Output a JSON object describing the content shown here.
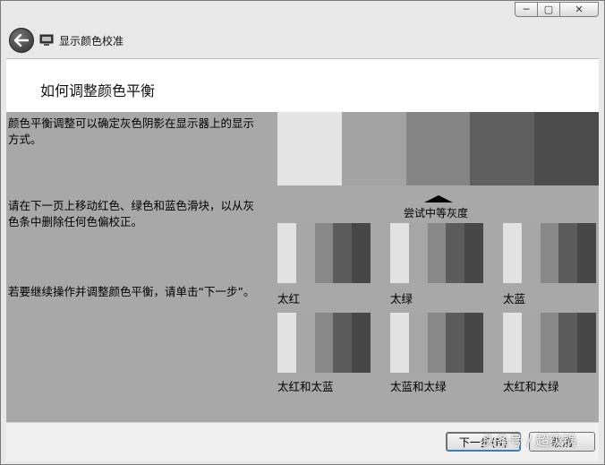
{
  "window": {
    "caption_buttons": [
      {
        "name": "minimize",
        "glyph": "─"
      },
      {
        "name": "maximize",
        "glyph": "▢"
      },
      {
        "name": "close",
        "glyph": "✕"
      }
    ]
  },
  "header": {
    "app_title": "显示颜色校准"
  },
  "page": {
    "title": "如何调整颜色平衡"
  },
  "instructions": [
    "颜色平衡调整可以确定灰色阴影在显示器上的显示方式。",
    "请在下一页上移动红色、绿色和蓝色滑块，以从灰色条中删除任何色偏校正。",
    "若要继续操作并调整颜色平衡，请单击“下一步”。"
  ],
  "reference": {
    "target_label": "尝试中等灰度",
    "colors": [
      "#e4e4e4",
      "#a3a3a3",
      "#858585",
      "#5f5f5f",
      "#4b4b4b"
    ]
  },
  "strip_colors": [
    "#e2e2e2",
    "#a6a6a6",
    "#888888",
    "#5c5c5c",
    "#474747"
  ],
  "samples": [
    {
      "label": "太红"
    },
    {
      "label": "太绿"
    },
    {
      "label": "太蓝"
    },
    {
      "label": "太红和太蓝"
    },
    {
      "label": "太蓝和太绿"
    },
    {
      "label": "太红和太绿"
    }
  ],
  "footer": {
    "next_label": "下一步(N)",
    "cancel_label": "取消"
  },
  "watermark": "头条号 / 超级锅"
}
